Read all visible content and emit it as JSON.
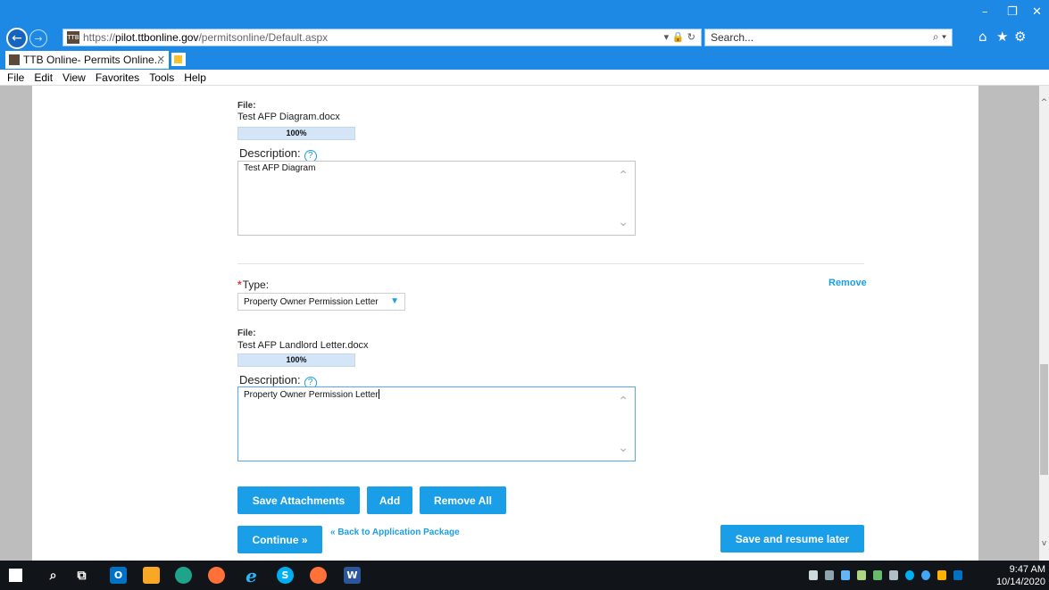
{
  "browser": {
    "url_prefix": "https://",
    "url_host": "pilot.ttbonline.gov",
    "url_path": "/permitsonline/Default.aspx",
    "search_placeholder": "Search...",
    "tab_title": "TTB Online- Permits Online...",
    "menu": [
      "File",
      "Edit",
      "View",
      "Favorites",
      "Tools",
      "Help"
    ],
    "accent": "#1e88e5"
  },
  "attachments": [
    {
      "file_label": "File:",
      "file_name": "Test AFP Diagram.docx",
      "progress_text": "100%",
      "progress": 100,
      "description_label": "Description:",
      "description": "Test AFP Diagram"
    },
    {
      "type_label": "Type:",
      "type_value": "Property Owner Permission Letter",
      "remove_label": "Remove",
      "file_label": "File:",
      "file_name": "Test AFP Landlord Letter.docx",
      "progress_text": "100%",
      "progress": 100,
      "description_label": "Description:",
      "description": "Property Owner Permission Letter"
    }
  ],
  "actions": {
    "save_attachments": "Save Attachments",
    "add": "Add",
    "remove_all": "Remove All",
    "continue": "Continue »",
    "back_link": "« Back to Application Package",
    "save_resume": "Save and resume later",
    "button_color": "#1a9ee8"
  },
  "taskbar": {
    "time": "9:47 AM",
    "date": "10/14/2020"
  }
}
